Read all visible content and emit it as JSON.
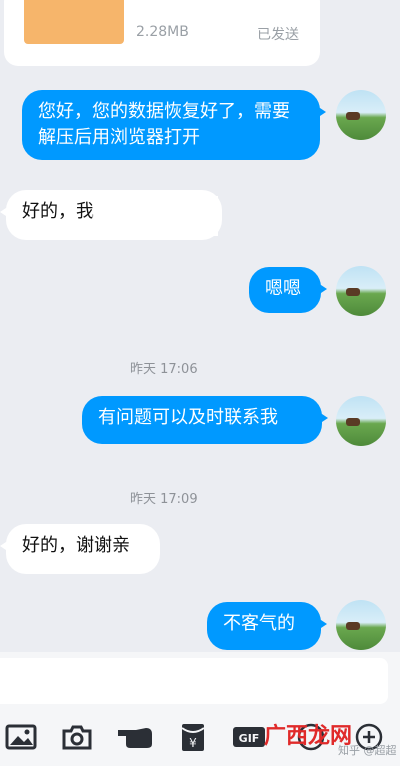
{
  "file_card": {
    "size": "2.28MB",
    "status": "已发送"
  },
  "messages": [
    {
      "dir": "out",
      "text": "您好，您的数据恢复好了，需要解压后用浏览器打开"
    },
    {
      "dir": "in",
      "text": "好的，我"
    },
    {
      "dir": "out",
      "text": "嗯嗯"
    },
    {
      "dir": "time",
      "text": "昨天 17:06"
    },
    {
      "dir": "out",
      "text": "有问题可以及时联系我"
    },
    {
      "dir": "time",
      "text": "昨天 17:09"
    },
    {
      "dir": "in",
      "text": "好的，谢谢亲"
    },
    {
      "dir": "out",
      "text": "不客气的"
    }
  ],
  "input": {
    "value": "",
    "placeholder": ""
  },
  "toolbar": {
    "icons": [
      "image-icon",
      "camera-icon",
      "emoji-hand-icon",
      "red-packet-icon",
      "gif-icon",
      "voice-icon",
      "more-icon"
    ]
  },
  "watermark": {
    "text": "广西龙网",
    "credit": "知乎 @超超"
  }
}
